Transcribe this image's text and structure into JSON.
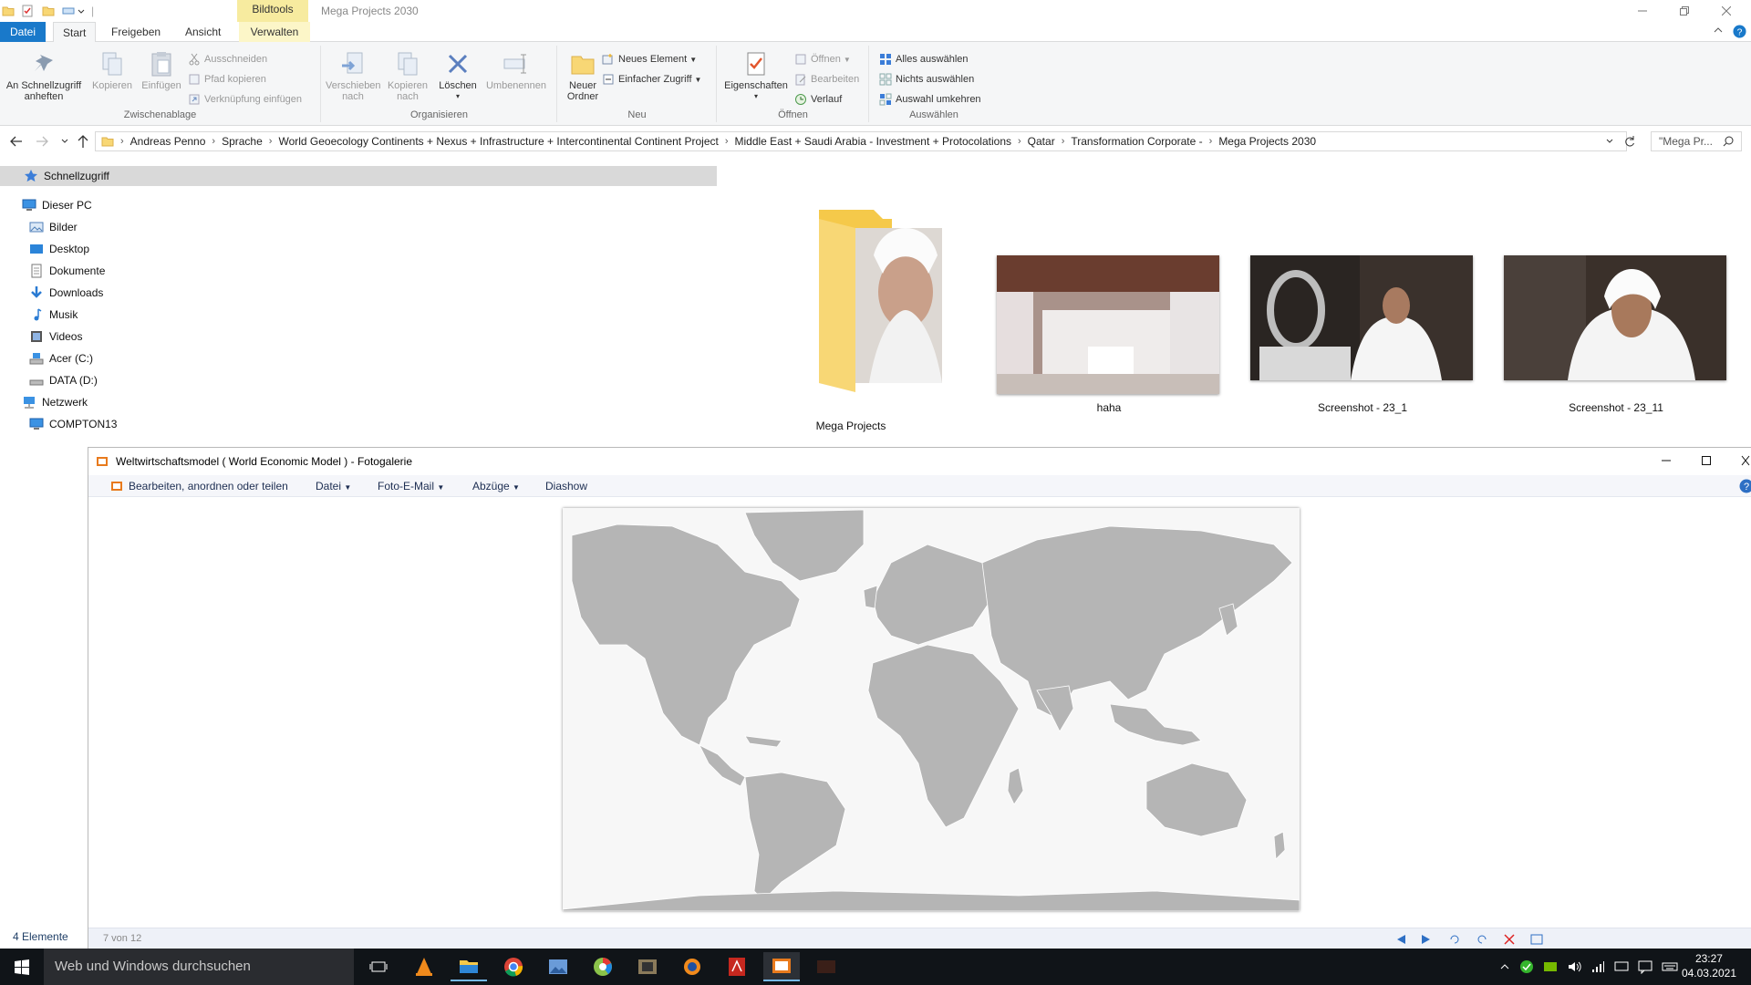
{
  "window": {
    "title": "Mega Projects 2030",
    "context_tab_header": "Bildtools"
  },
  "tabs": [
    "Datei",
    "Start",
    "Freigeben",
    "Ansicht",
    "Verwalten"
  ],
  "ribbon": {
    "clipboard": {
      "pin_label_1": "An Schnellzugriff",
      "pin_label_2": "anheften",
      "copy": "Kopieren",
      "paste": "Einfügen",
      "cut": "Ausschneiden",
      "copy_path": "Pfad kopieren",
      "paste_shortcut": "Verknüpfung einfügen",
      "group": "Zwischenablage"
    },
    "organize": {
      "move_1": "Verschieben",
      "move_2": "nach",
      "copyto_1": "Kopieren",
      "copyto_2": "nach",
      "delete": "Löschen",
      "rename": "Umbenennen",
      "group": "Organisieren"
    },
    "new": {
      "folder_1": "Neuer",
      "folder_2": "Ordner",
      "new_item": "Neues Element",
      "easy_access": "Einfacher Zugriff",
      "group": "Neu"
    },
    "open": {
      "properties": "Eigenschaften",
      "open": "Öffnen",
      "edit": "Bearbeiten",
      "history": "Verlauf",
      "group": "Öffnen"
    },
    "select": {
      "select_all": "Alles auswählen",
      "select_none": "Nichts auswählen",
      "invert": "Auswahl umkehren",
      "group": "Auswählen"
    }
  },
  "address": {
    "crumbs": [
      "Andreas Penno",
      "Sprache",
      "World Geoecology Continents + Nexus + Infrastructure + Intercontinental Continent Project",
      "Middle East + Saudi Arabia - Investment + Protocolations",
      "Qatar",
      "Transformation Corporate -",
      "Mega Projects 2030"
    ],
    "search_placeholder": "\"Mega Pr..."
  },
  "nav": {
    "quick_access": "Schnellzugriff",
    "this_pc": "Dieser PC",
    "items": [
      "Bilder",
      "Desktop",
      "Dokumente",
      "Downloads",
      "Musik",
      "Videos",
      "Acer (C:)",
      "DATA (D:)"
    ],
    "network": "Netzwerk",
    "network_items": [
      "COMPTON13"
    ]
  },
  "files": [
    {
      "name": "Mega Projects",
      "type": "folder"
    },
    {
      "name": "haha",
      "type": "image"
    },
    {
      "name": "Screenshot - 23_1",
      "type": "image"
    },
    {
      "name": "Screenshot - 23_11",
      "type": "image"
    }
  ],
  "status": {
    "item_count": "4 Elemente"
  },
  "gallery": {
    "title": "Weltwirtschaftsmodel ( World Economic Model ) - Fotogalerie",
    "menu": [
      "Bearbeiten, anordnen oder teilen",
      "Datei",
      "Foto-E-Mail",
      "Abzüge",
      "Diashow"
    ],
    "counter": "7 von 12"
  },
  "taskbar": {
    "search_placeholder": "Web und Windows durchsuchen",
    "time": "23:27",
    "date": "04.03.2021"
  },
  "colors": {
    "accent": "#1979ca",
    "context_tab": "#f7eb9f",
    "taskbar": "#101418"
  }
}
